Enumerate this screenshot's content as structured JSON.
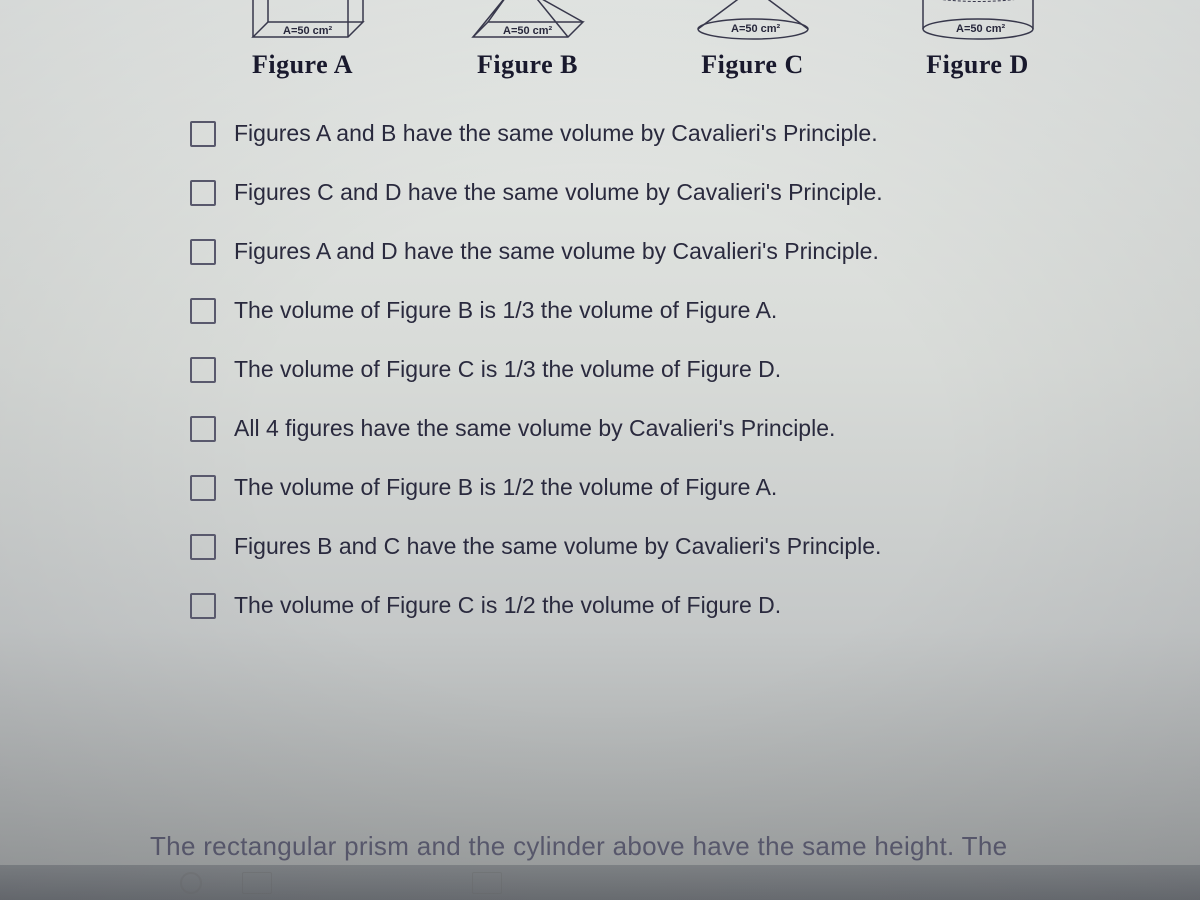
{
  "figures": {
    "areaLabel": "A=50 cm²",
    "a": {
      "label": "Figure A",
      "area": "A=50 cm²"
    },
    "b": {
      "label": "Figure B",
      "area": "A=50 cm²"
    },
    "c": {
      "label": "Figure C",
      "area": "A=50 cm²"
    },
    "d": {
      "label": "Figure D",
      "area": "A=50 cm²"
    }
  },
  "options": [
    "Figures A and B have the same volume by Cavalieri's Principle.",
    "Figures C and D have the same volume by Cavalieri's Principle.",
    "Figures A and D have the same volume by Cavalieri's Principle.",
    "The volume of Figure B is 1/3 the volume of Figure A.",
    "The volume of Figure C is 1/3 the volume of Figure D.",
    "All 4 figures have the same volume by Cavalieri's Principle.",
    "The volume of Figure B is 1/2 the volume of Figure A.",
    "Figures B and C have the same volume by Cavalieri's Principle.",
    "The volume of Figure C is 1/2 the volume of Figure D."
  ],
  "bottomText": "The rectangular prism and the cylinder above have the same height. The"
}
